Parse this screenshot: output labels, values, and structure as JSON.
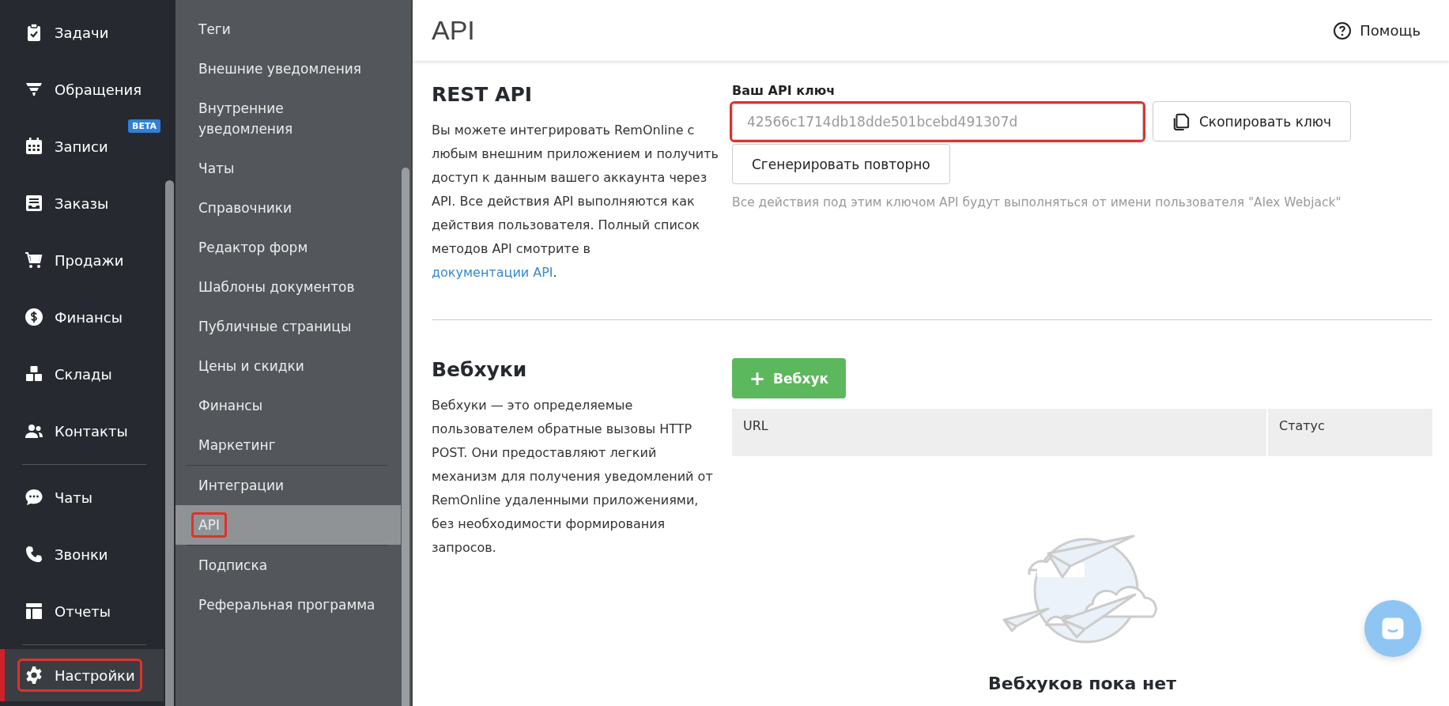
{
  "nav": {
    "groups": [
      [
        {
          "label": "Задачи",
          "selected": false,
          "highlighted": false
        },
        {
          "label": "Обращения",
          "selected": false,
          "highlighted": false
        },
        {
          "label": "Записи",
          "selected": false,
          "highlighted": false,
          "badge": "BETA"
        },
        {
          "label": "Заказы",
          "selected": false,
          "highlighted": false
        },
        {
          "label": "Продажи",
          "selected": false,
          "highlighted": false
        },
        {
          "label": "Финансы",
          "selected": false,
          "highlighted": false
        },
        {
          "label": "Склады",
          "selected": false,
          "highlighted": false
        },
        {
          "label": "Контакты",
          "selected": false,
          "highlighted": false
        }
      ],
      [
        {
          "label": "Чаты",
          "selected": false,
          "highlighted": false
        },
        {
          "label": "Звонки",
          "selected": false,
          "highlighted": false
        },
        {
          "label": "Отчеты",
          "selected": false,
          "highlighted": false
        }
      ],
      [
        {
          "label": "Настройки",
          "selected": true,
          "highlighted": true
        }
      ]
    ]
  },
  "settings_menu": {
    "groups": [
      [
        {
          "label": "Теги",
          "selected": false,
          "highlighted": false
        },
        {
          "label": "Внешние уведомления",
          "selected": false,
          "highlighted": false
        },
        {
          "label": "Внутренние уведомления",
          "selected": false,
          "highlighted": false
        },
        {
          "label": "Чаты",
          "selected": false,
          "highlighted": false
        },
        {
          "label": "Справочники",
          "selected": false,
          "highlighted": false
        },
        {
          "label": "Редактор форм",
          "selected": false,
          "highlighted": false
        },
        {
          "label": "Шаблоны документов",
          "selected": false,
          "highlighted": false
        },
        {
          "label": "Публичные страницы",
          "selected": false,
          "highlighted": false
        },
        {
          "label": "Цены и скидки",
          "selected": false,
          "highlighted": false
        },
        {
          "label": "Финансы",
          "selected": false,
          "highlighted": false
        },
        {
          "label": "Маркетинг",
          "selected": false,
          "highlighted": false
        }
      ],
      [
        {
          "label": "Интеграции",
          "selected": false,
          "highlighted": false
        },
        {
          "label": "API",
          "selected": true,
          "highlighted": true
        }
      ],
      [
        {
          "label": "Подписка",
          "selected": false,
          "highlighted": false
        },
        {
          "label": "Реферальная программа",
          "selected": false,
          "highlighted": false
        }
      ]
    ]
  },
  "header": {
    "title": "API",
    "help": "Помощь"
  },
  "rest_api": {
    "title": "REST API",
    "description": "Вы можете интегрировать RemOnline с любым внешним приложением и получить доступ к данным вашего аккаунта через API. Все действия API выполняются как действия пользователя. Полный список методов API смотрите в ",
    "link": "документации API",
    "description_end": ".",
    "key_label": "Ваш API ключ",
    "key_value": "42566c1714db18dde501bcebd491307d",
    "key_highlighted": true,
    "copy_button": "Скопировать ключ",
    "regenerate_button": "Сгенерировать повторно",
    "note": "Все действия под этим ключом API будут выполняться от имени пользователя \"Alex Webjack\""
  },
  "webhooks": {
    "title": "Вебхуки",
    "description": "Вебхуки — это определяемые пользователем обратные вызовы HTTP POST. Они предоставляют легкий механизм для получения уведомлений от RemOnline удаленными приложениями, без необходимости формирования запросов.",
    "add_button_icon": "+",
    "add_button": "Вебхук",
    "table": {
      "columns": [
        "URL",
        "Статус"
      ]
    },
    "empty_text": "Вебхуков пока нет"
  }
}
